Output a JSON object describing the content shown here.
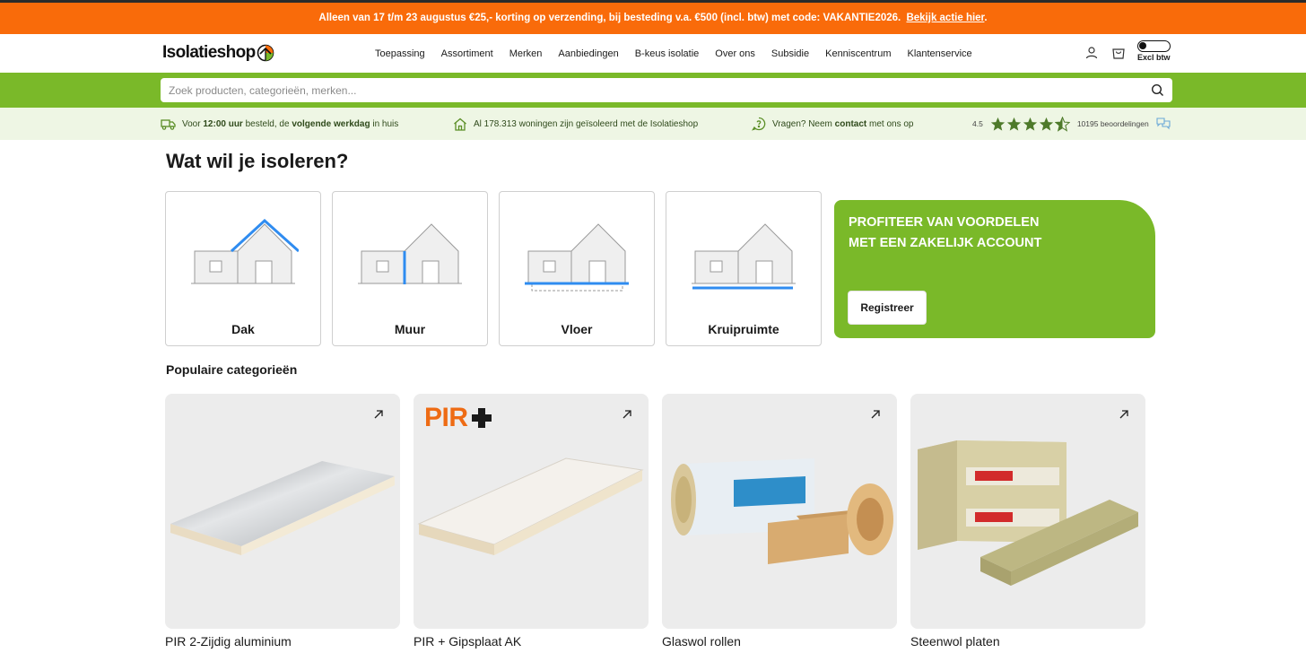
{
  "topbar": {
    "text": "Alleen van 17 t/m 23 augustus €25,- korting op verzending, bij besteding v.a. €500 (incl. btw) met code: VAKANTIE2026.",
    "link": "Bekijk actie hier",
    "suffix": "."
  },
  "header": {
    "logo": "Isolatieshop",
    "nav": [
      "Toepassing",
      "Assortiment",
      "Merken",
      "Aanbiedingen",
      "B-keus isolatie",
      "Over ons",
      "Subsidie",
      "Kenniscentrum",
      "Klantenservice"
    ],
    "vat_toggle_label": "Excl btw",
    "icons": [
      "user-icon",
      "cart-icon"
    ]
  },
  "search": {
    "placeholder": "Zoek producten, categorieën, merken..."
  },
  "usp": {
    "delivery": {
      "pre": "Voor",
      "time": "12:00 uur",
      "mid": "besteld, de",
      "bold": "volgende werkdag",
      "post": "in huis"
    },
    "homes": "Al 178.313 woningen zijn geïsoleerd met de Isolatieshop",
    "contact": {
      "pre": "Vragen? Neem",
      "bold": "contact",
      "post": "met ons op"
    },
    "rating": {
      "score": "4.5",
      "stars": 4.5,
      "reviews": "10195 beoordelingen"
    }
  },
  "main": {
    "title": "Wat wil je isoleren?",
    "categories": [
      {
        "label": "Dak",
        "highlight": "roof"
      },
      {
        "label": "Muur",
        "highlight": "wall"
      },
      {
        "label": "Vloer",
        "highlight": "floor"
      },
      {
        "label": "Kruipruimte",
        "highlight": "crawlspace"
      }
    ],
    "promo": {
      "text": "PROFITEER VAN VOORDELEN MET EEN ZAKELIJK ACCOUNT",
      "button": "Registreer"
    },
    "popular_title": "Populaire categorieën",
    "products": [
      {
        "name": "PIR 2-Zijdig aluminium"
      },
      {
        "name": "PIR + Gipsplaat AK",
        "badge": "PIR"
      },
      {
        "name": "Glaswol rollen"
      },
      {
        "name": "Steenwol platen"
      }
    ]
  },
  "colors": {
    "orange": "#f96b0a",
    "green": "#7ab929",
    "light_green": "#eef6e4",
    "highlight_blue": "#2f8cf0"
  }
}
